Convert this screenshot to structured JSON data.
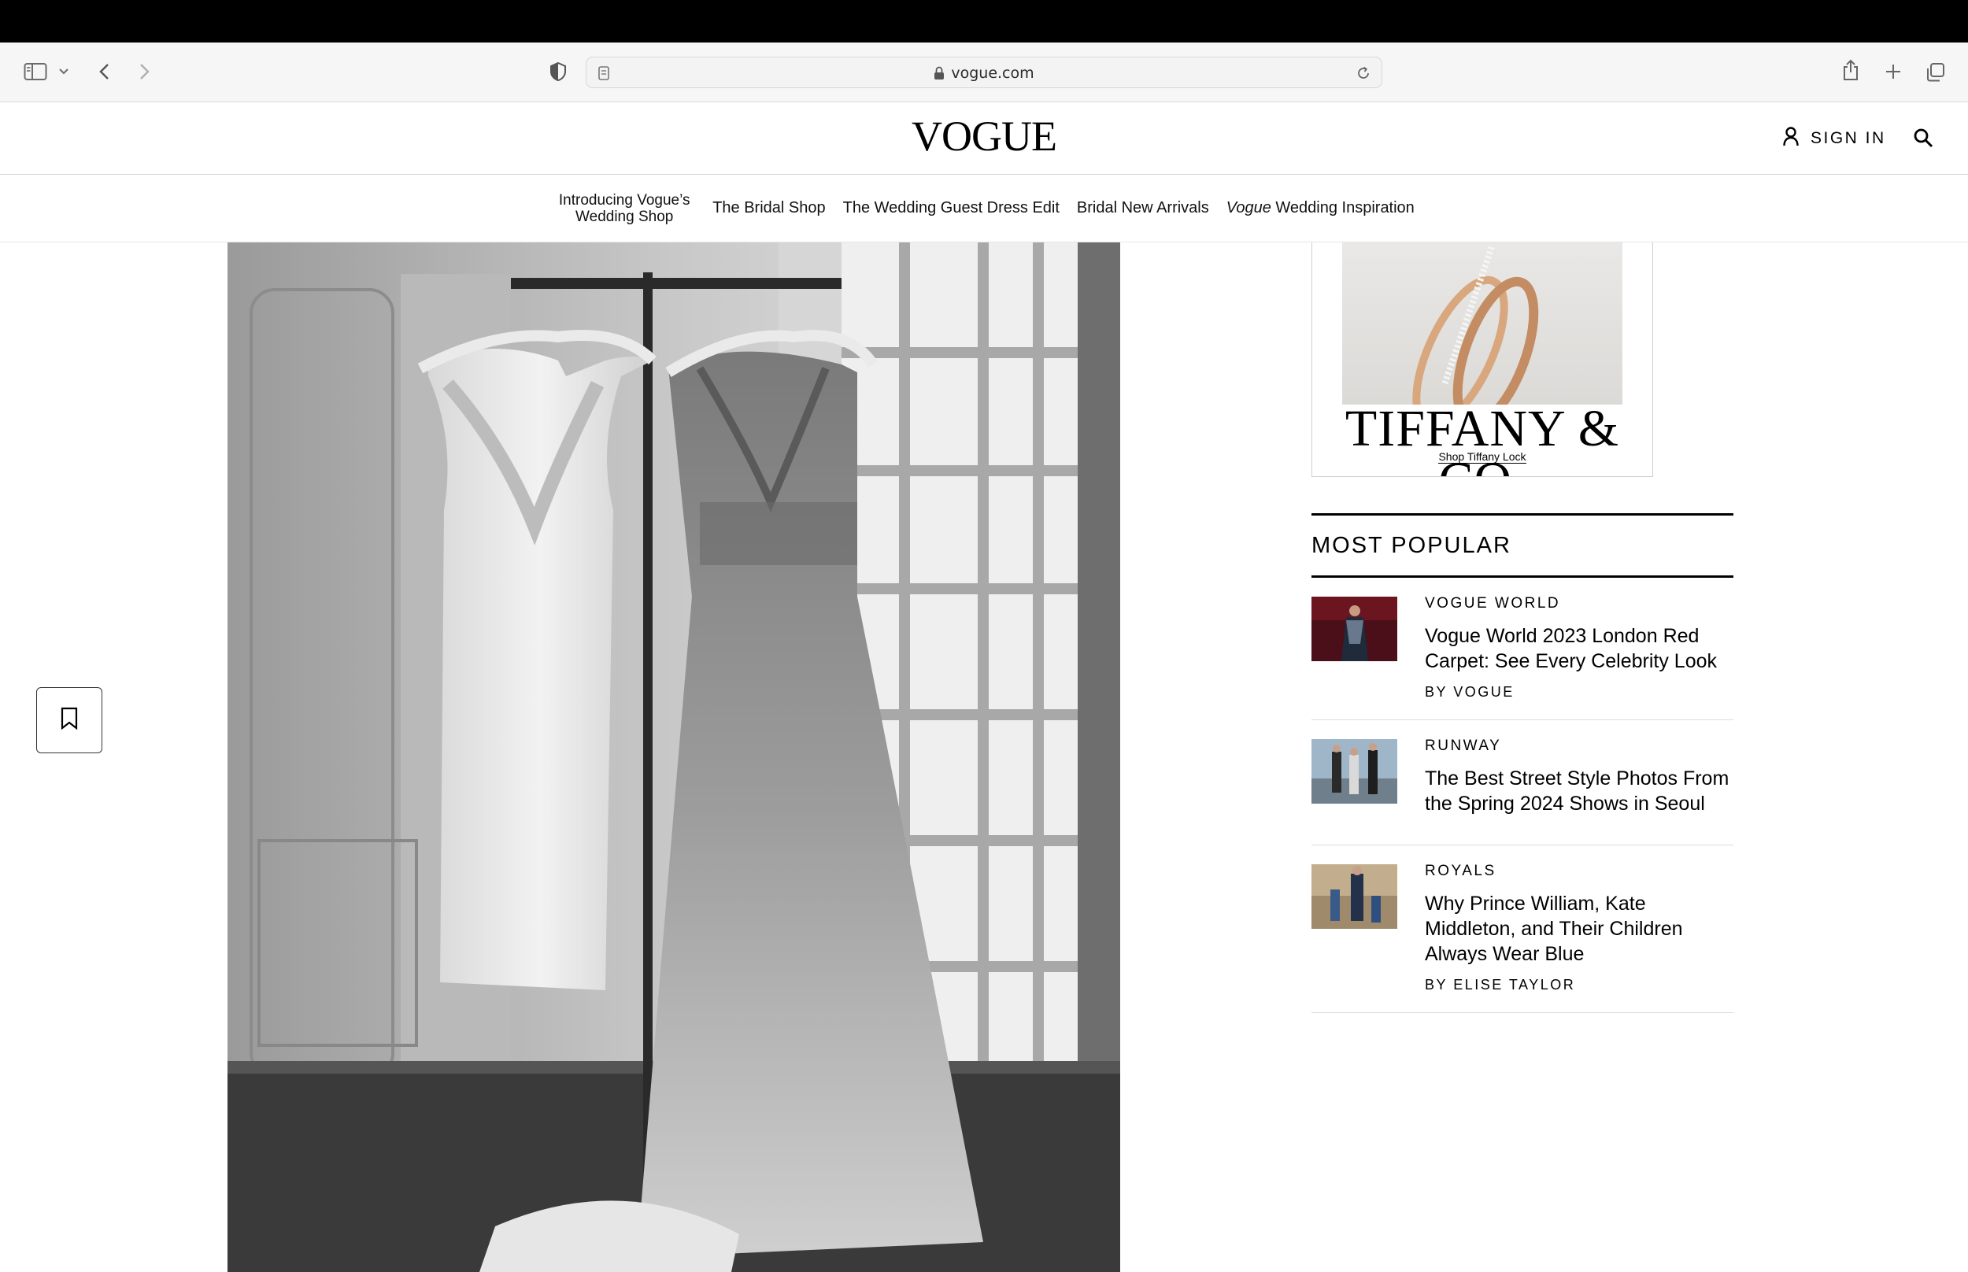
{
  "browser": {
    "url": "vogue.com",
    "icons": {
      "sidebar": "sidebar-toggle-icon",
      "chevron": "chevron-down-icon",
      "back": "back-arrow-icon",
      "forward": "forward-arrow-icon",
      "privacy": "privacy-shield-icon",
      "page": "page-icon",
      "lock": "lock-icon",
      "reload": "reload-icon",
      "share": "share-icon",
      "new_tab": "plus-icon",
      "tabs": "tabs-overview-icon"
    }
  },
  "header": {
    "logo": "VOGUE",
    "sign_in": "SIGN IN",
    "icons": {
      "account": "user-icon",
      "search": "search-icon"
    }
  },
  "nav": {
    "items": [
      {
        "label": "Introducing Vogue’s Wedding Shop"
      },
      {
        "label": "The Bridal Shop"
      },
      {
        "label": "The Wedding Guest Dress Edit"
      },
      {
        "label": "Bridal New Arrivals"
      },
      {
        "label_italic": "Vogue",
        "label": " Wedding Inspiration"
      }
    ]
  },
  "article": {
    "save_icon": "bookmark-icon",
    "hero_alt": "two wedding dresses hanging on a rack by a window"
  },
  "ad": {
    "brand": "TIFFANY & CO.",
    "link": "Shop Tiffany Lock"
  },
  "most_popular": {
    "heading": "MOST POPULAR",
    "items": [
      {
        "category": "VOGUE WORLD",
        "title": "Vogue World 2023 London Red Carpet: See Every Celebrity Look",
        "byline": "BY VOGUE"
      },
      {
        "category": "RUNWAY",
        "title": "The Best Street Style Photos From the Spring 2024 Shows in Seoul",
        "byline": ""
      },
      {
        "category": "ROYALS",
        "title": "Why Prince William, Kate Middleton, and Their Children Always Wear Blue",
        "byline": "BY ELISE TAYLOR"
      }
    ]
  }
}
